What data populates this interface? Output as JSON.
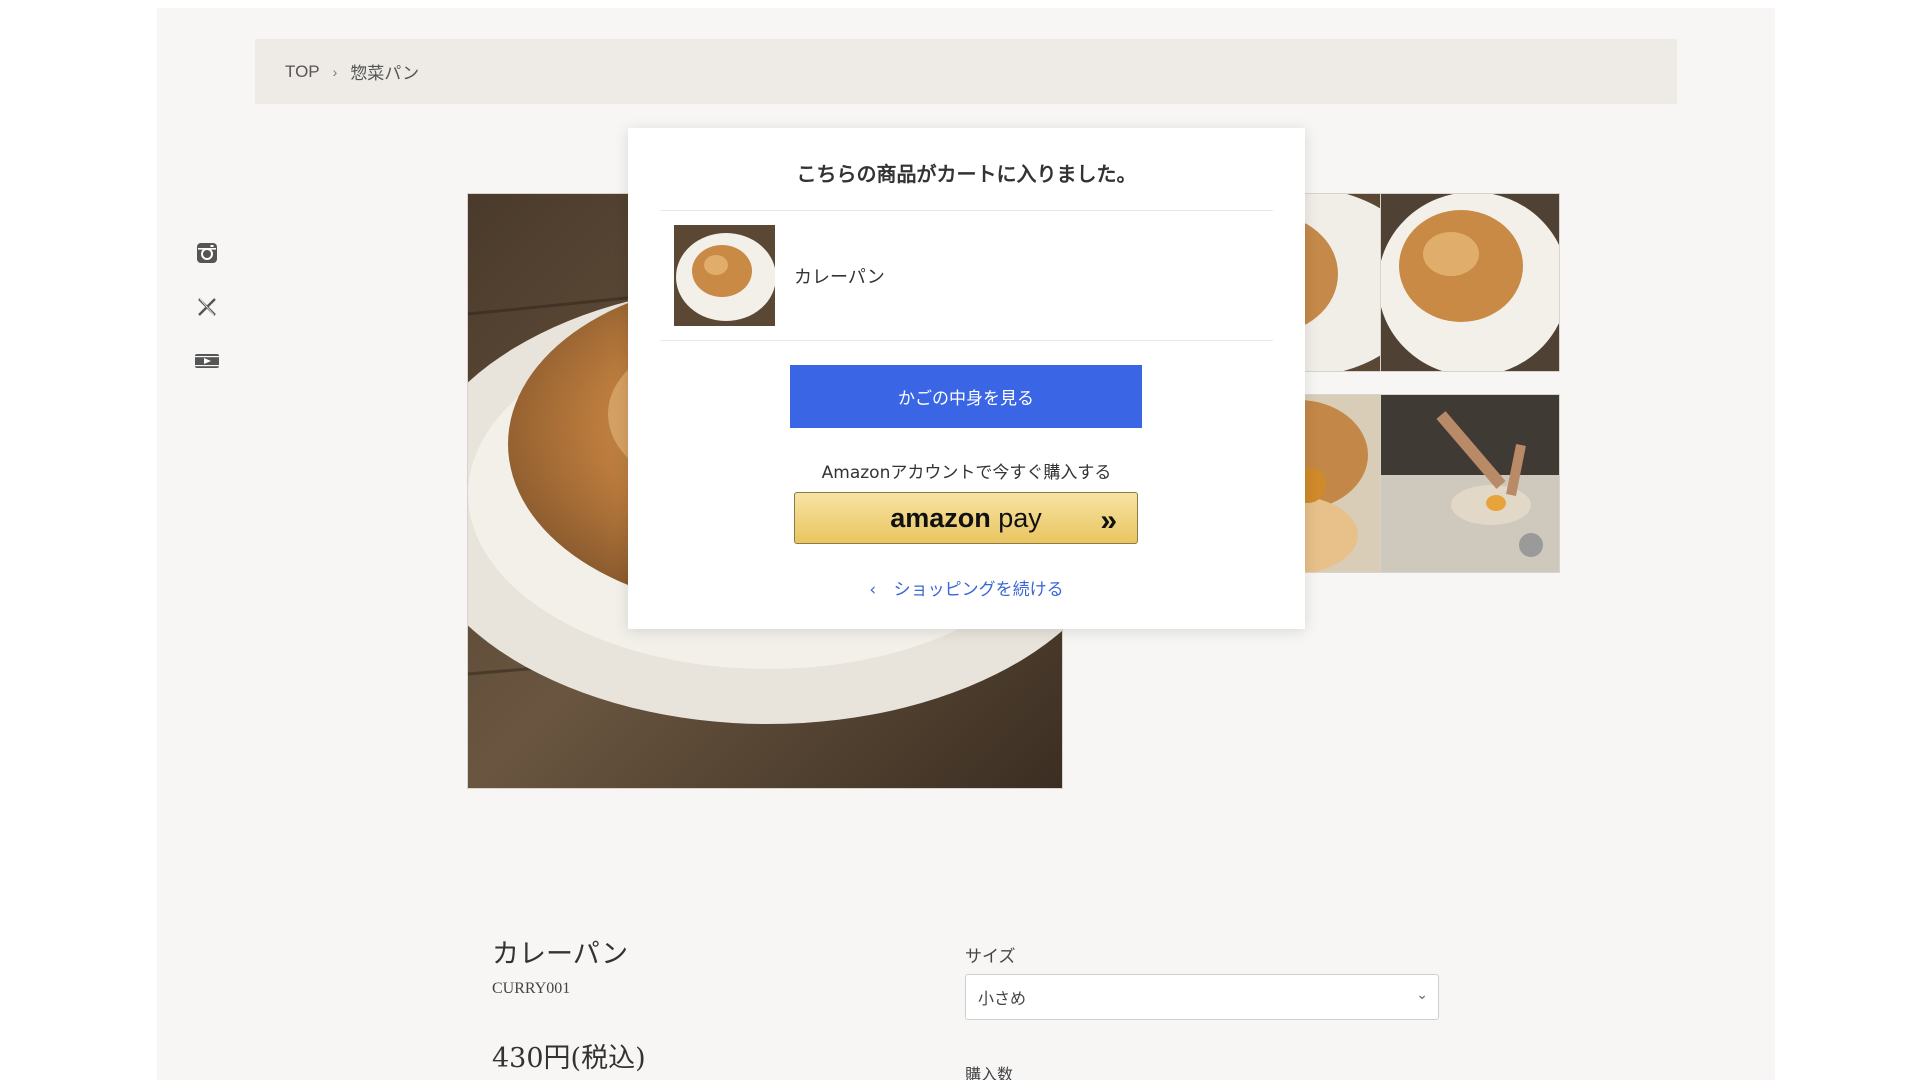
{
  "breadcrumb": {
    "home": "TOP",
    "separator": "›",
    "current": "惣菜パン"
  },
  "social": {
    "icons": [
      "instagram-icon",
      "x-icon",
      "youtube-icon"
    ]
  },
  "product": {
    "name": "カレーパン",
    "code": "CURRY001",
    "price": "430円(税込)",
    "size_label": "サイズ",
    "size_value": "小さめ",
    "quantity_label": "購入数"
  },
  "modal": {
    "title": "こちらの商品がカートに入りました。",
    "item_name": "カレーパン",
    "cart_button": "かごの中身を見る",
    "amazon_text": "Amazonアカウントで今すぐ購入する",
    "amazon_brand": "amazon",
    "amazon_pay": "pay",
    "amazon_arrows": "»",
    "continue_icon": "‹",
    "continue_label": "ショッピングを続ける"
  },
  "colors": {
    "accent_blue": "#3a66e6",
    "link_blue": "#3a66d6",
    "page_bg": "#f7f6f4",
    "breadcrumb_bg": "#eeebe6"
  }
}
